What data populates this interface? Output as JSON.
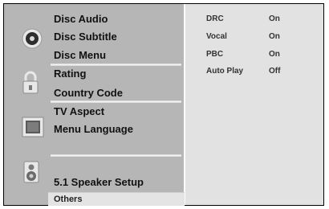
{
  "menu": {
    "disc_group": {
      "items": [
        "Disc Audio",
        "Disc Subtitle",
        "Disc Menu"
      ],
      "icon": "disc-icon"
    },
    "lock_group": {
      "items": [
        "Rating",
        "Country Code"
      ],
      "icon": "padlock-icon"
    },
    "display_group": {
      "items": [
        "TV Aspect",
        "Menu Language"
      ],
      "icon": "tv-screen-icon"
    },
    "speaker_group": {
      "items": [
        "5.1 Speaker Setup"
      ],
      "icon": "speaker-icon"
    },
    "selected_tab": "Others"
  },
  "options": [
    {
      "name": "DRC",
      "value": "On"
    },
    {
      "name": "Vocal",
      "value": "On"
    },
    {
      "name": "PBC",
      "value": "On"
    },
    {
      "name": "Auto Play",
      "value": "Off"
    }
  ],
  "colors": {
    "menu_panel": "#b6b6b6",
    "settings_panel": "#e2e2e2",
    "selected_tab": "#e4e4e4"
  }
}
